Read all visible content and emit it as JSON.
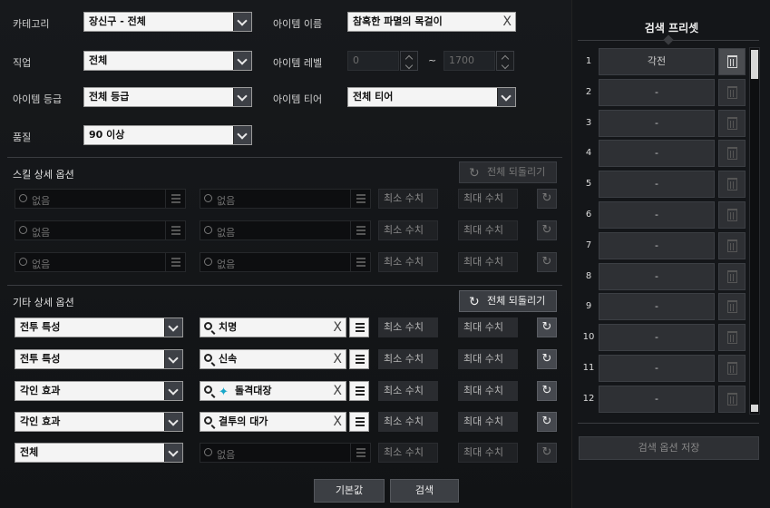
{
  "filters": {
    "category_label": "카테고리",
    "category_value": "장신구 - 전체",
    "item_name_label": "아이템 이름",
    "item_name_value": "참혹한 파멸의 목걸이",
    "class_label": "직업",
    "class_value": "전체",
    "level_label": "아이템 레벨",
    "level_min": "0",
    "level_sep": "~",
    "level_max": "1700",
    "grade_label": "아이템 등급",
    "grade_value": "전체 등급",
    "tier_label": "아이템 티어",
    "tier_value": "전체 티어",
    "quality_label": "품질",
    "quality_value": "90 이상",
    "clear": "X"
  },
  "skill": {
    "title": "스킬 상세 옵션",
    "reset": "전체 되돌리기",
    "rows": [
      {
        "a": "없음",
        "b": "없음",
        "min": "최소 수치",
        "max": "최대 수치"
      },
      {
        "a": "없음",
        "b": "없음",
        "min": "최소 수치",
        "max": "최대 수치"
      },
      {
        "a": "없음",
        "b": "없음",
        "min": "최소 수치",
        "max": "최대 수치"
      }
    ]
  },
  "etc": {
    "title": "기타 상세 옵션",
    "reset": "전체 되돌리기",
    "rows": [
      {
        "type": "전투 특성",
        "value": "치명",
        "min": "최소 수치",
        "max": "최대 수치"
      },
      {
        "type": "전투 특성",
        "value": "신속",
        "min": "최소 수치",
        "max": "최대 수치"
      },
      {
        "type": "각인 효과",
        "value": "돌격대장",
        "min": "최소 수치",
        "max": "최대 수치"
      },
      {
        "type": "각인 효과",
        "value": "결투의 대가",
        "min": "최소 수치",
        "max": "최대 수치"
      },
      {
        "type": "전체",
        "value": "없음",
        "min": "최소 수치",
        "max": "최대 수치"
      }
    ]
  },
  "buttons": {
    "default": "기본값",
    "search": "검색"
  },
  "preset": {
    "title": "검색 프리셋",
    "save": "검색 옵션 저장",
    "items": [
      {
        "n": "1",
        "label": "각전"
      },
      {
        "n": "2",
        "label": "-"
      },
      {
        "n": "3",
        "label": "-"
      },
      {
        "n": "4",
        "label": "-"
      },
      {
        "n": "5",
        "label": "-"
      },
      {
        "n": "6",
        "label": "-"
      },
      {
        "n": "7",
        "label": "-"
      },
      {
        "n": "8",
        "label": "-"
      },
      {
        "n": "9",
        "label": "-"
      },
      {
        "n": "10",
        "label": "-"
      },
      {
        "n": "11",
        "label": "-"
      },
      {
        "n": "12",
        "label": "-"
      }
    ]
  },
  "icons": {
    "reset": "refresh-icon",
    "search": "search-icon",
    "menu": "list-icon",
    "trash": "trash-icon",
    "gem": "engraving-gem-icon"
  }
}
